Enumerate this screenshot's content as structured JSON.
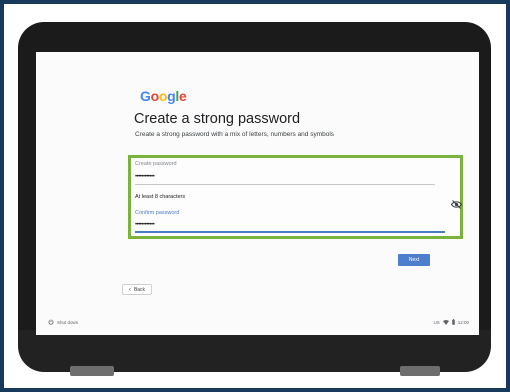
{
  "page": {
    "logo_letters": [
      "G",
      "o",
      "o",
      "g",
      "l",
      "e"
    ],
    "title": "Create a strong password",
    "subtitle": "Create a strong password with a mix of letters, numbers and symbols"
  },
  "form": {
    "create_label": "Create password",
    "create_value": "••••••••••••",
    "hint": "At least 8 characters",
    "confirm_label": "Confirm password",
    "confirm_value": "••••••••••••",
    "toggle_icon": "eye-off-icon",
    "highlight_color": "#7ab33c"
  },
  "actions": {
    "next_label": "Next",
    "back_label": "Back"
  },
  "shelf": {
    "shutdown_label": "Shut down",
    "locale": "US",
    "time": "12:00"
  },
  "colors": {
    "accent": "#4e7fcf",
    "frame": "#173a5c"
  }
}
